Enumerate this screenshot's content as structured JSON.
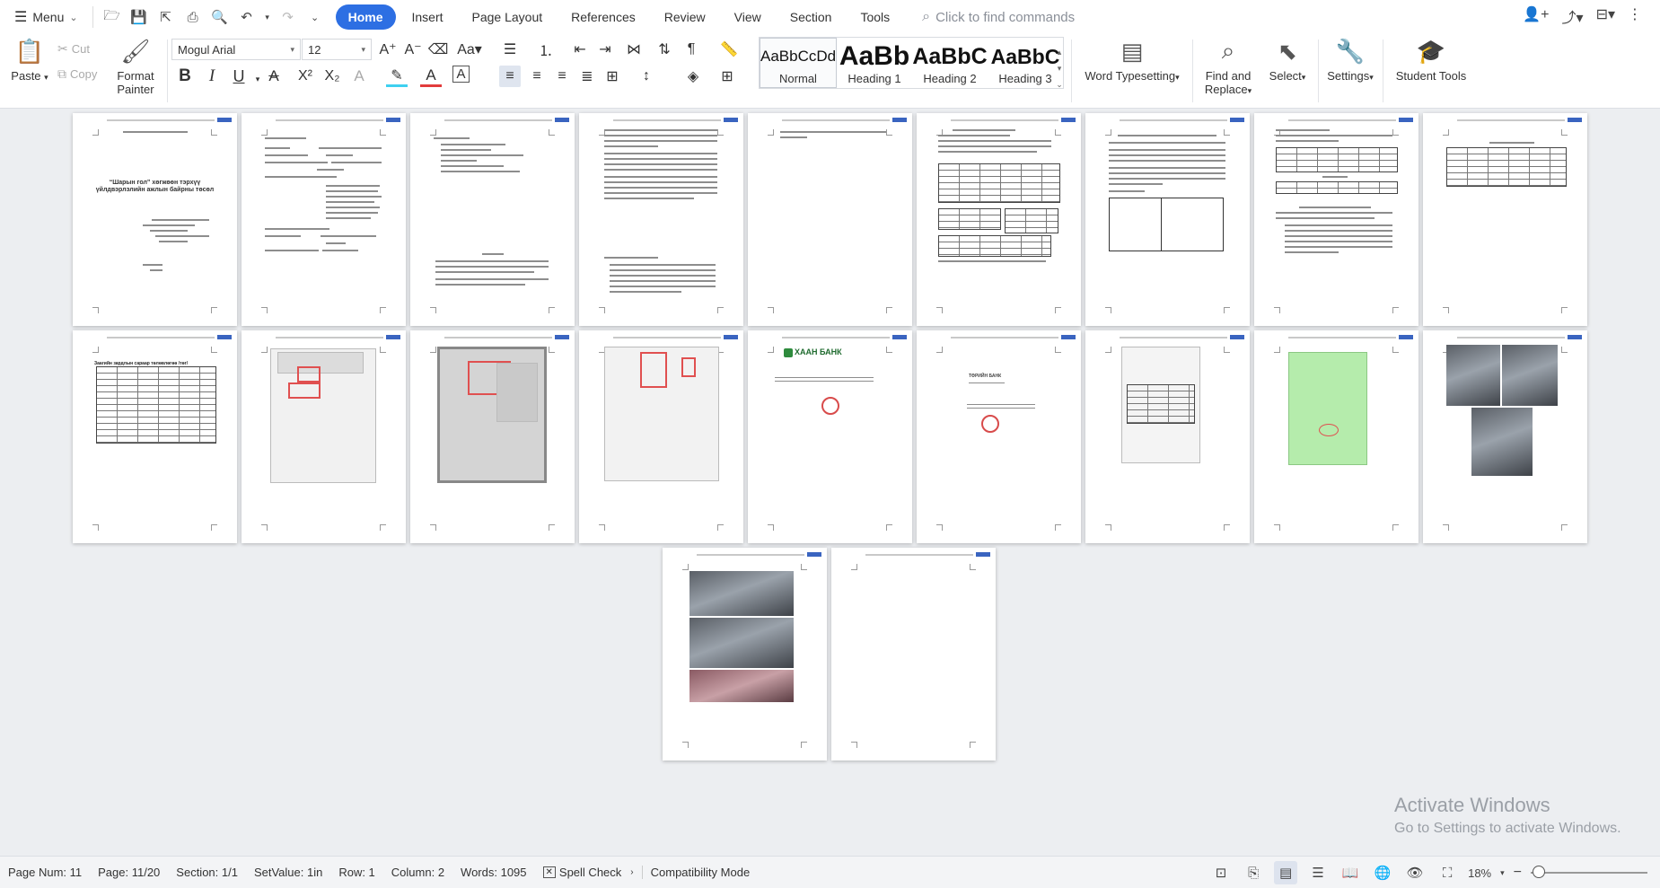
{
  "menubar": {
    "menu_label": "Menu",
    "tabs": [
      {
        "label": "Home"
      },
      {
        "label": "Insert"
      },
      {
        "label": "Page Layout"
      },
      {
        "label": "References"
      },
      {
        "label": "Review"
      },
      {
        "label": "View"
      },
      {
        "label": "Section"
      },
      {
        "label": "Tools"
      }
    ],
    "active_tab": "Home",
    "find_placeholder": "Click to find commands"
  },
  "ribbon": {
    "paste_label": "Paste",
    "cut_label": "Cut",
    "copy_label": "Copy",
    "format_painter_line1": "Format",
    "format_painter_line2": "Painter",
    "font_name": "Mogul Arial",
    "font_size": "12",
    "styles": [
      {
        "sample": "AaBbCcDd",
        "label": "Normal"
      },
      {
        "sample": "AaBb",
        "label": "Heading 1"
      },
      {
        "sample": "AaBbC",
        "label": "Heading 2"
      },
      {
        "sample": "AaBbC",
        "label": "Heading 3"
      }
    ],
    "word_typesetting_label": "Word Typesetting",
    "find_replace_line1": "Find and",
    "find_replace_line2": "Replace",
    "select_label": "Select",
    "settings_label": "Settings",
    "student_tools_label": "Student Tools",
    "accent_color": "#2d6fe3"
  },
  "document": {
    "page1_title": "“Шарын гол” хөгжөөн тэрхүү\nүйлдвэрлэлийн ажлын байрны төсөл",
    "bank1_name": "ХААН БАНК",
    "bank2_name": "ТӨРИЙН БАНК",
    "table_title": "Заагийн зардлын сараар төлөвлөгөө /төг/"
  },
  "watermark": {
    "line1": "Activate Windows",
    "line2": "Go to Settings to activate Windows."
  },
  "statusbar": {
    "page_num": "Page Num: 11",
    "page": "Page: 11/20",
    "section": "Section: 1/1",
    "set_value": "SetValue: 1in",
    "row": "Row: 1",
    "column": "Column: 2",
    "words": "Words: 1095",
    "spell_check": "Spell Check",
    "compat_mode": "Compatibility Mode",
    "zoom": "18%"
  }
}
